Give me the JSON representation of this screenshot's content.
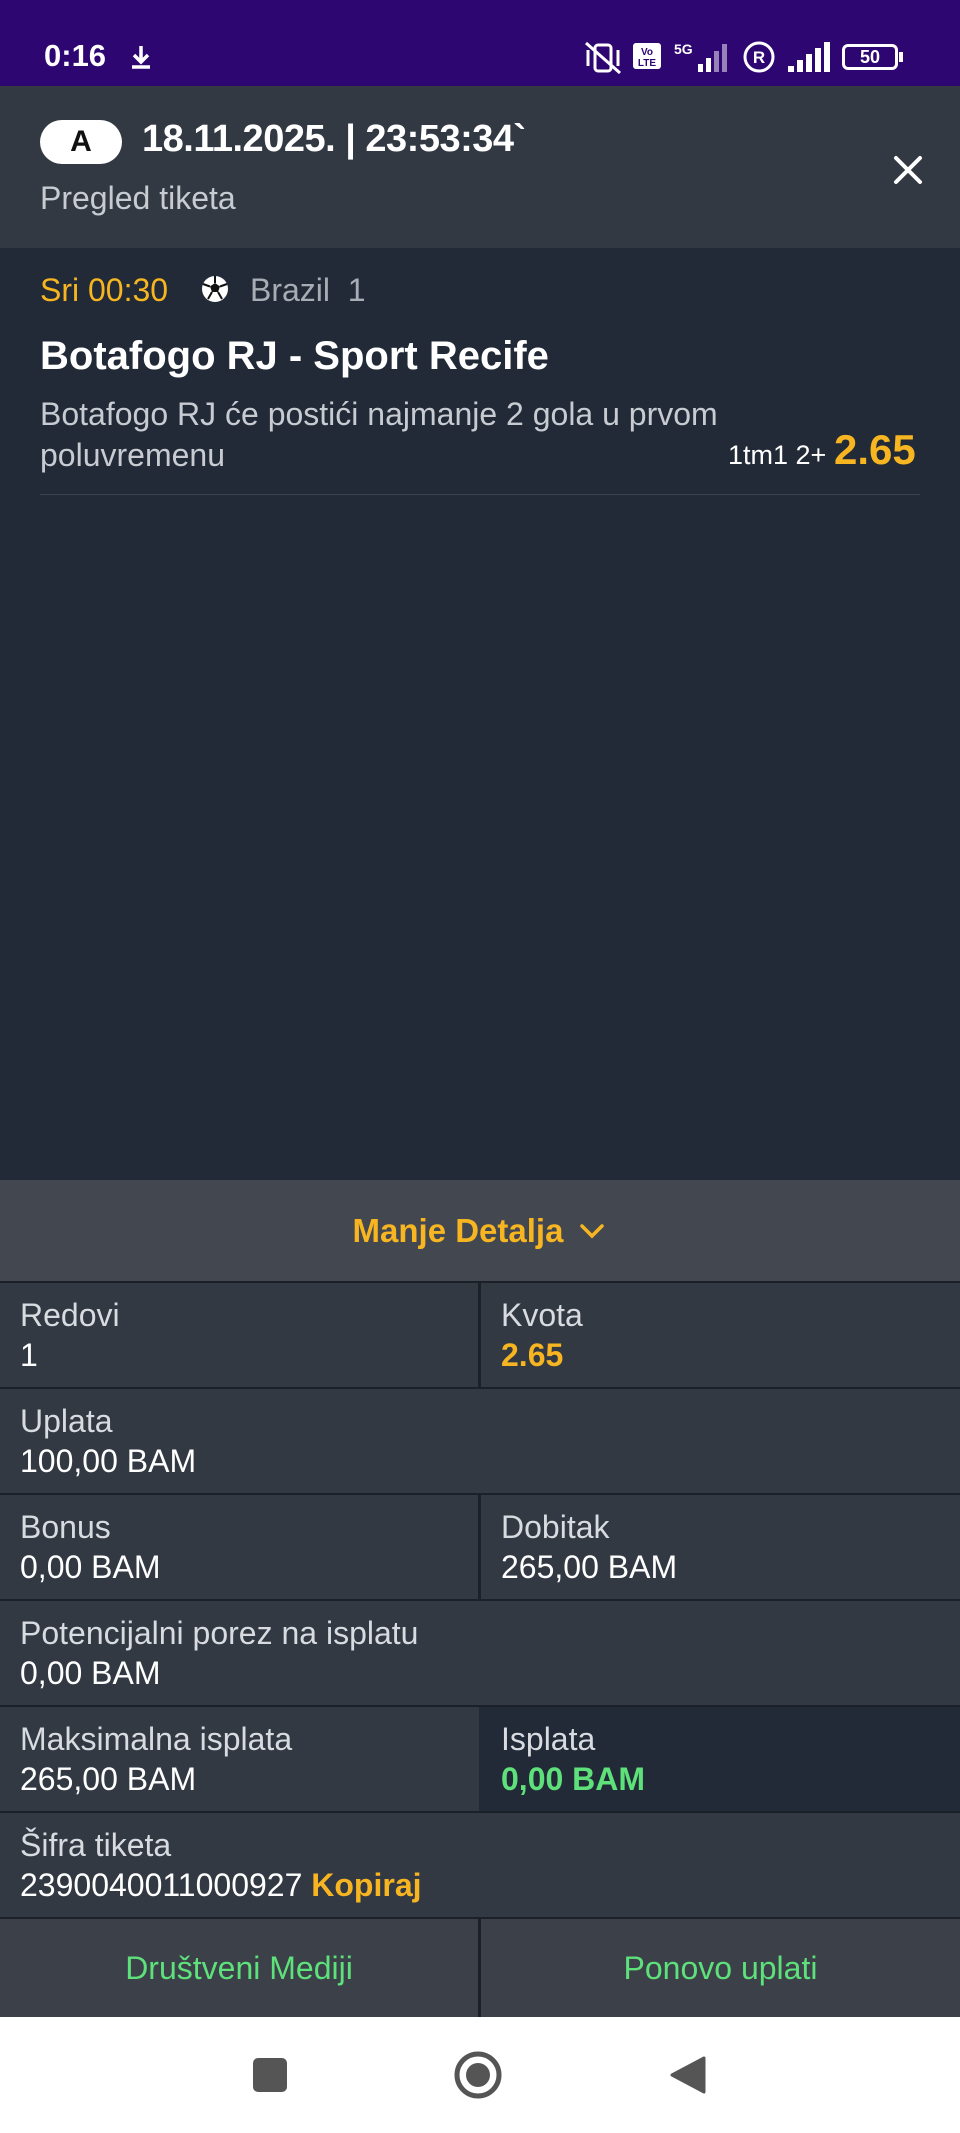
{
  "status_bar": {
    "time": "0:16",
    "battery": "50",
    "network": "5G",
    "icons": [
      "download-icon",
      "mute-vibrate-icon",
      "volte-icon",
      "signal-5g-icon",
      "roaming-icon",
      "signal-icon",
      "battery-icon"
    ]
  },
  "header": {
    "account_badge": "A",
    "datetime": "18.11.2025. | 23:53:34`",
    "subtitle": "Pregled tiketa"
  },
  "match": {
    "time": "Sri 00:30",
    "sport_icon": "soccer-ball-icon",
    "league": "Brazil  1",
    "title": "Botafogo RJ - Sport Recife",
    "description": "Botafogo RJ će postići najmanje 2 gola u prvom poluvremenu",
    "bet_code": "1tm1 2+",
    "odd": "2.65"
  },
  "details": {
    "toggle_label": "Manje Detalja",
    "rows_label": "Redovi",
    "rows_value": "1",
    "odds_label": "Kvota",
    "odds_value": "2.65",
    "stake_label": "Uplata",
    "stake_value": "100,00 BAM",
    "bonus_label": "Bonus",
    "bonus_value": "0,00 BAM",
    "win_label": "Dobitak",
    "win_value": "265,00 BAM",
    "tax_label": "Potencijalni porez na isplatu",
    "tax_value": "0,00 BAM",
    "max_payout_label": "Maksimalna isplata",
    "max_payout_value": "265,00 BAM",
    "payout_label": "Isplata",
    "payout_value": "0,00 BAM",
    "ticket_code_label": "Šifra tiketa",
    "ticket_code_value": "2390040011000927",
    "copy_label": "Kopiraj"
  },
  "actions": {
    "social_label": "Društveni Mediji",
    "replay_label": "Ponovo uplati"
  },
  "colors": {
    "accent": "#f7b521",
    "success": "#5ee07a",
    "status_bar": "#2e0672",
    "background": "#212a36",
    "panel": "#323943"
  }
}
